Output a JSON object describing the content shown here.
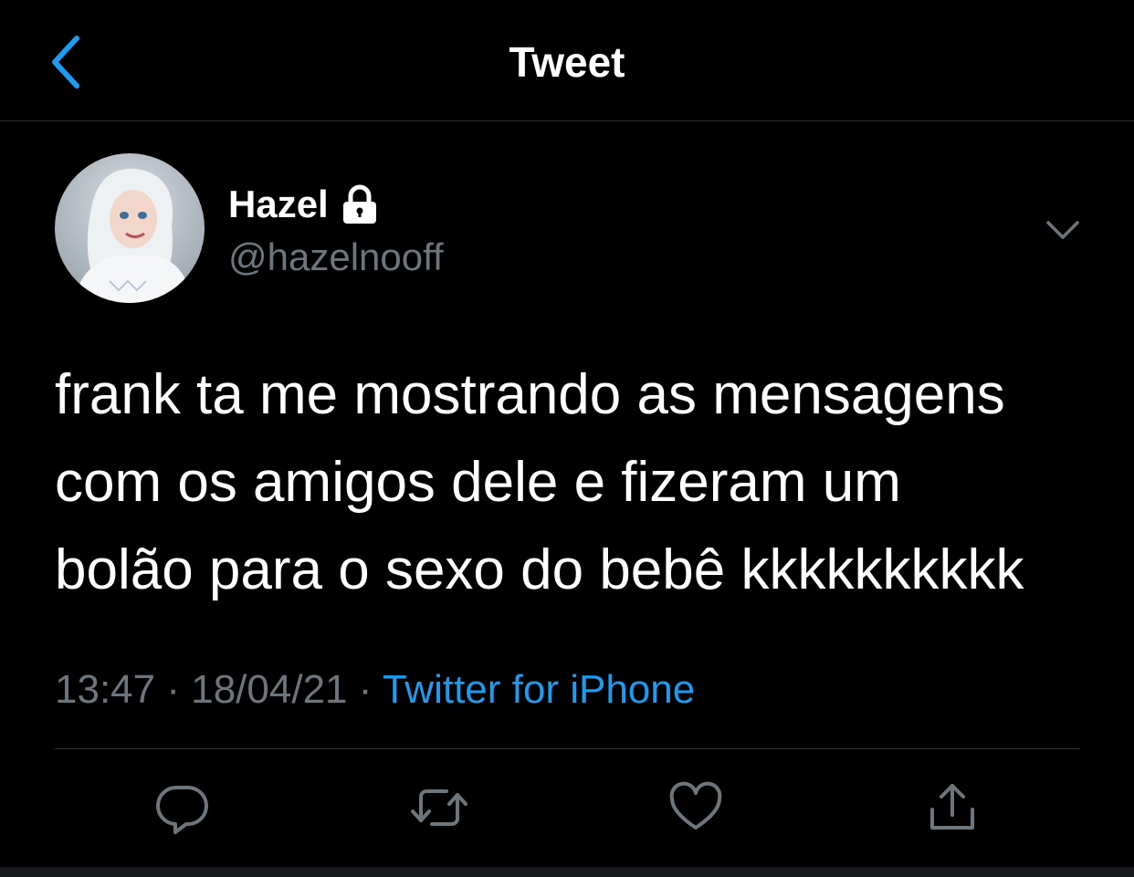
{
  "header": {
    "title": "Tweet",
    "back_icon": "chevron-left-icon"
  },
  "colors": {
    "background": "#000000",
    "text": "#ffffff",
    "muted": "#6e767d",
    "accent": "#1d9bf0",
    "divider": "#2f3336"
  },
  "tweet": {
    "author": {
      "name": "Hazel",
      "handle": "@hazelnooff",
      "protected_icon": "lock-icon",
      "avatar": "avatar-image"
    },
    "menu_icon": "chevron-down-icon",
    "text_lines": [
      "frank ta me mostrando as mensagens",
      "com os amigos dele e fizeram um",
      "bolão para o sexo do bebê kkkkkkkkkk"
    ],
    "time": "13:47",
    "separator": "·",
    "date": "18/04/21",
    "source": "Twitter for iPhone"
  },
  "actions": [
    {
      "name": "reply",
      "icon": "reply-icon"
    },
    {
      "name": "retweet",
      "icon": "retweet-icon"
    },
    {
      "name": "like",
      "icon": "heart-icon"
    },
    {
      "name": "share",
      "icon": "share-icon"
    }
  ]
}
